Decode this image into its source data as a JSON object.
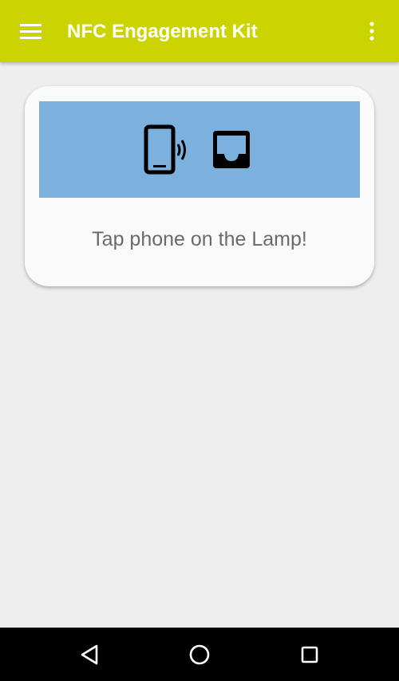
{
  "app_bar": {
    "title": "NFC Engagement Kit",
    "menu_icon": "hamburger-menu-icon",
    "overflow_icon": "more-vert-icon",
    "background_color": "#ccd400"
  },
  "card": {
    "banner_color": "#7bb1dc",
    "icons": [
      "phone-nfc-icon",
      "inbox-icon"
    ],
    "instruction": "Tap phone on the Lamp!"
  },
  "nav_bar": {
    "back_icon": "back-triangle-icon",
    "home_icon": "home-circle-icon",
    "recents_icon": "recents-square-icon"
  }
}
